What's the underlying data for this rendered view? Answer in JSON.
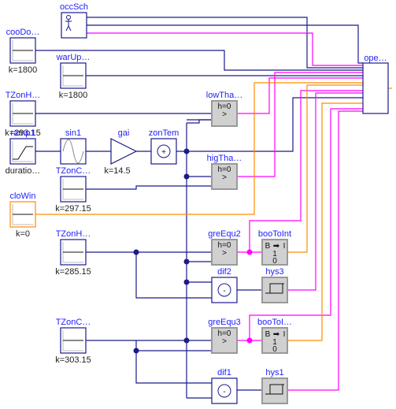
{
  "colors": {
    "real": "#1a1a8c",
    "boolean": "#ff00ff",
    "integer": "#ff8c00",
    "label": "#2020ff",
    "logic_fill": "#d0d0d0"
  },
  "blocks": [
    {
      "id": "occSch",
      "label": "occSch",
      "param": "",
      "kind": "occupancy-schedule",
      "icon": "person-icon"
    },
    {
      "id": "cooDo",
      "label": "cooDo…",
      "param": "k=1800",
      "kind": "constant"
    },
    {
      "id": "warUp",
      "label": "warUp…",
      "param": "k=1800",
      "kind": "constant"
    },
    {
      "id": "TZonH1",
      "label": "TZonH…",
      "param": "k=293.15",
      "kind": "constant"
    },
    {
      "id": "ramp1",
      "label": "ramp1",
      "param": "duratio…",
      "kind": "ramp"
    },
    {
      "id": "sin1",
      "label": "sin1",
      "param": "",
      "kind": "sine"
    },
    {
      "id": "gai",
      "label": "gai",
      "param": "k=14.5",
      "kind": "gain"
    },
    {
      "id": "zonTem",
      "label": "zonTem",
      "param": "",
      "kind": "add",
      "symbol": "+"
    },
    {
      "id": "TZonC1",
      "label": "TZonC…",
      "param": "k=297.15",
      "kind": "constant"
    },
    {
      "id": "cloWin",
      "label": "cloWin",
      "param": "k=0",
      "kind": "int-constant"
    },
    {
      "id": "TZonH2",
      "label": "TZonH…",
      "param": "k=285.15",
      "kind": "constant"
    },
    {
      "id": "TZonC2",
      "label": "TZonC…",
      "param": "k=303.15",
      "kind": "constant"
    },
    {
      "id": "lowTha",
      "label": "lowTha…",
      "param": "h=0",
      "kind": "greater",
      "symbol": ">"
    },
    {
      "id": "higTha",
      "label": "higTha…",
      "param": "h=0",
      "kind": "greater",
      "symbol": ">"
    },
    {
      "id": "greEqu2",
      "label": "greEqu2",
      "param": "h=0",
      "kind": "greater",
      "symbol": ">"
    },
    {
      "id": "booToInt",
      "label": "booToInt",
      "param": "",
      "kind": "booToInt",
      "symbol": "B",
      "values": [
        "1",
        "0"
      ],
      "arrow": "I"
    },
    {
      "id": "dif2",
      "label": "dif2",
      "param": "",
      "kind": "subtract",
      "symbol": "-"
    },
    {
      "id": "hys3",
      "label": "hys3",
      "param": "",
      "kind": "hysteresis"
    },
    {
      "id": "greEqu3",
      "label": "greEqu3",
      "param": "h=0",
      "kind": "greater",
      "symbol": ">"
    },
    {
      "id": "booToI",
      "label": "booToI…",
      "param": "",
      "kind": "booToInt",
      "symbol": "B",
      "values": [
        "1",
        "0"
      ],
      "arrow": "I"
    },
    {
      "id": "dif1",
      "label": "dif1",
      "param": "",
      "kind": "subtract",
      "symbol": "-"
    },
    {
      "id": "hys1",
      "label": "hys1",
      "param": "",
      "kind": "hysteresis"
    },
    {
      "id": "ope",
      "label": "ope…",
      "param": "",
      "kind": "controller"
    }
  ]
}
